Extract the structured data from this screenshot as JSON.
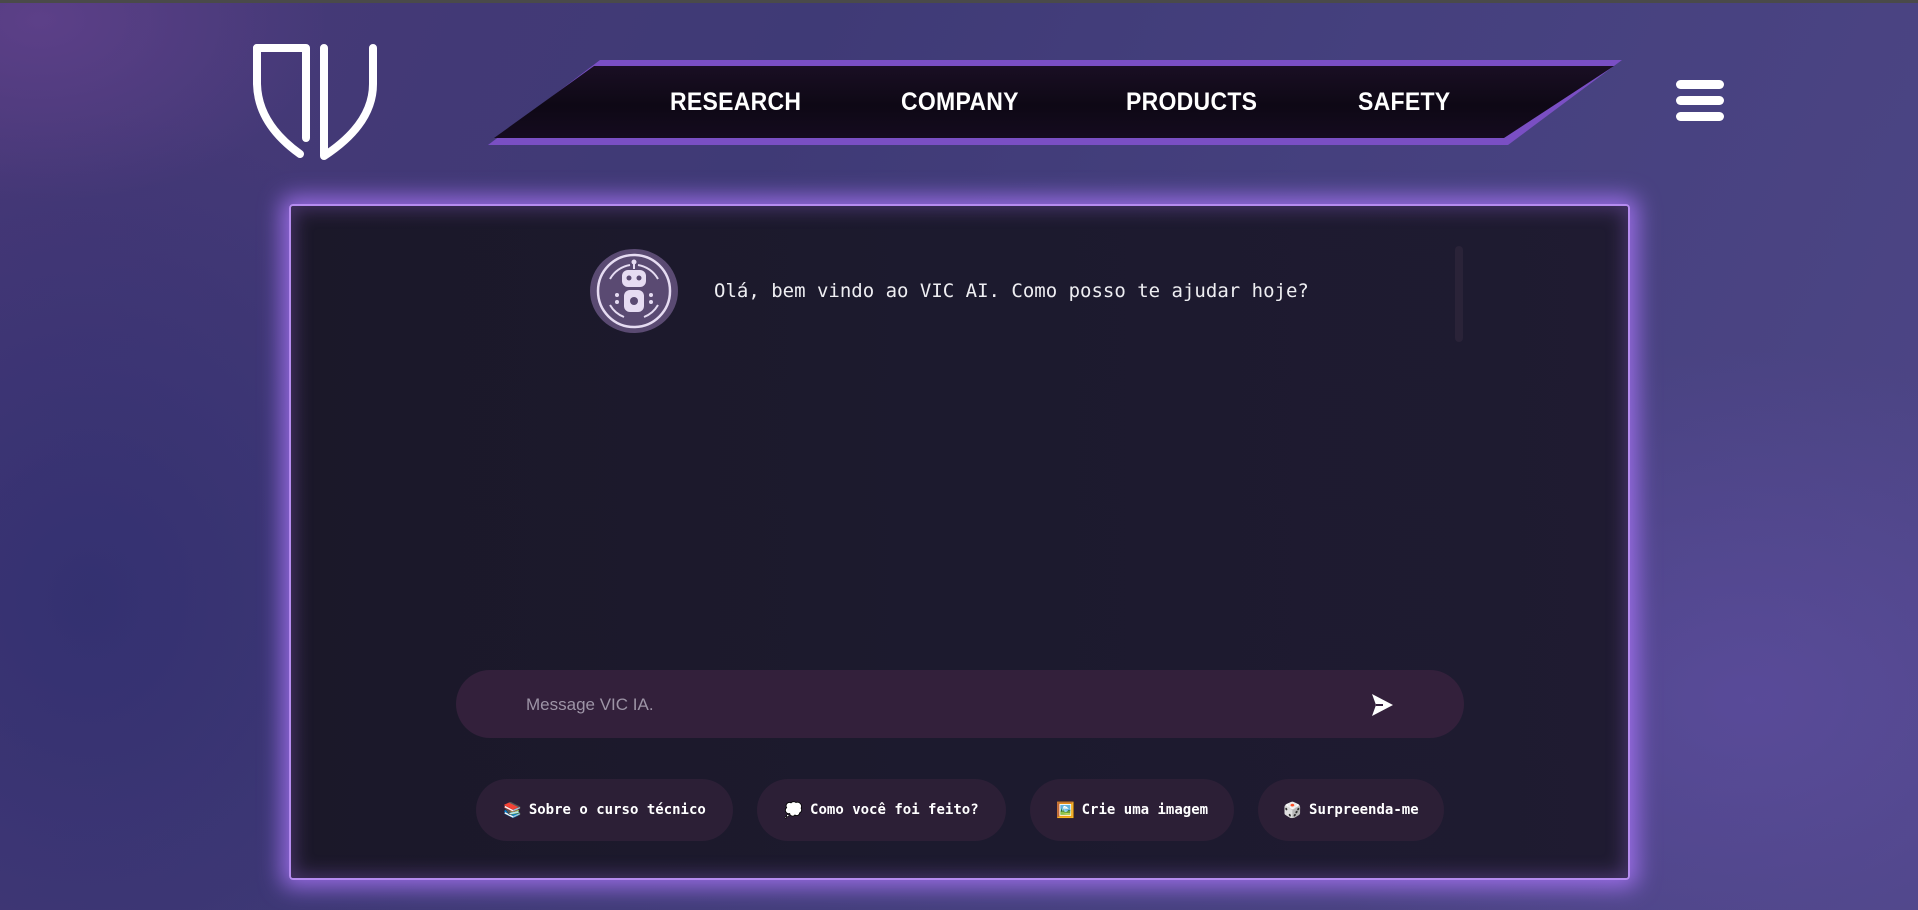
{
  "nav": {
    "items": [
      {
        "label": "RESEARCH"
      },
      {
        "label": "COMPANY"
      },
      {
        "label": "PRODUCTS"
      },
      {
        "label": "SAFETY"
      }
    ]
  },
  "chat": {
    "bot_message": "Olá, bem vindo ao VIC AI. Como posso te ajudar hoje?",
    "input_placeholder": "Message VIC IA.",
    "input_value": ""
  },
  "suggestions": [
    {
      "icon": "books-icon",
      "glyph": "📚",
      "label": "Sobre o curso técnico"
    },
    {
      "icon": "speech-bubble-icon",
      "glyph": "💭",
      "label": "Como você foi feito?"
    },
    {
      "icon": "picture-icon",
      "glyph": "🖼️",
      "label": "Crie uma imagem"
    },
    {
      "icon": "dice-icon",
      "glyph": "🎲",
      "label": "Surpreenda-me"
    }
  ],
  "colors": {
    "accent_glow": "#b68cf0",
    "panel_bg": "#1c1a2e",
    "input_bg": "#33203b",
    "chip_bg": "#2c1f36"
  }
}
